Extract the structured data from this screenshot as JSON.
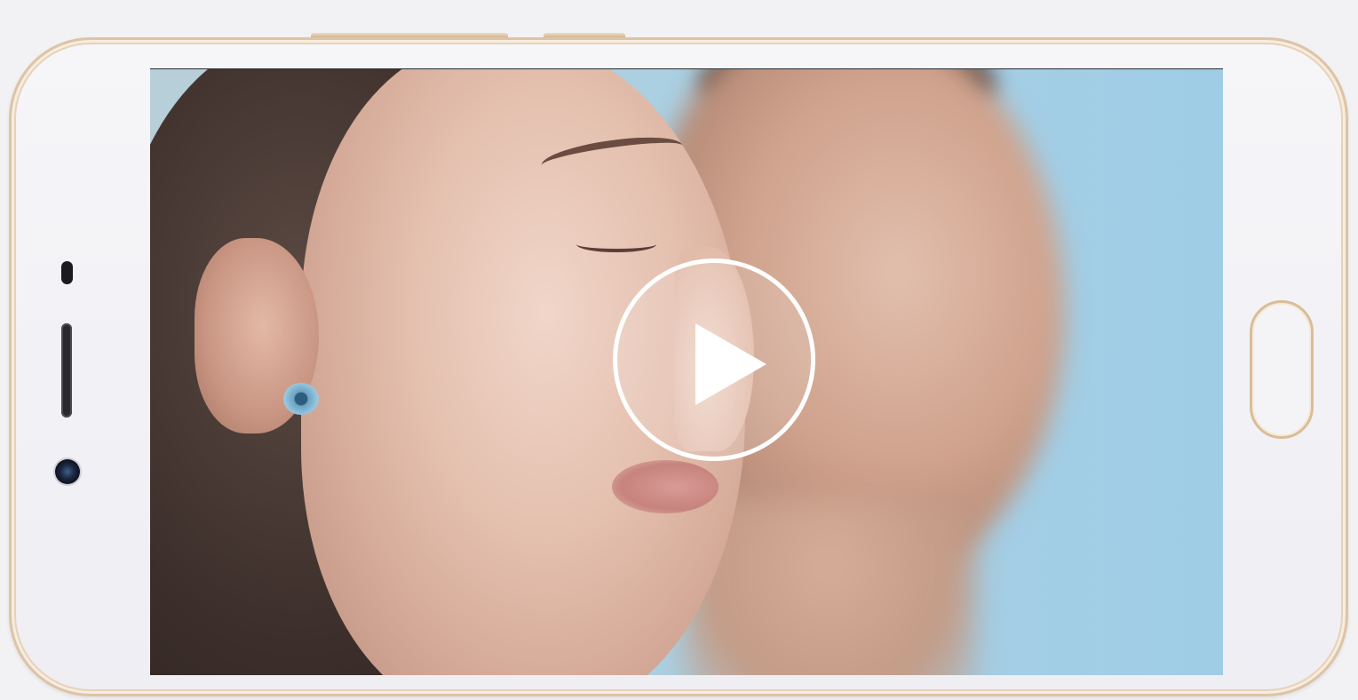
{
  "device": {
    "orientation": "landscape",
    "frame_color": "#dcc4a6",
    "body_color": "#f2f2f4"
  },
  "video": {
    "state": "paused",
    "overlay_icon": "play-icon"
  },
  "icons": {
    "play": "play-icon",
    "home": "home-button-icon",
    "camera": "front-camera-icon"
  }
}
